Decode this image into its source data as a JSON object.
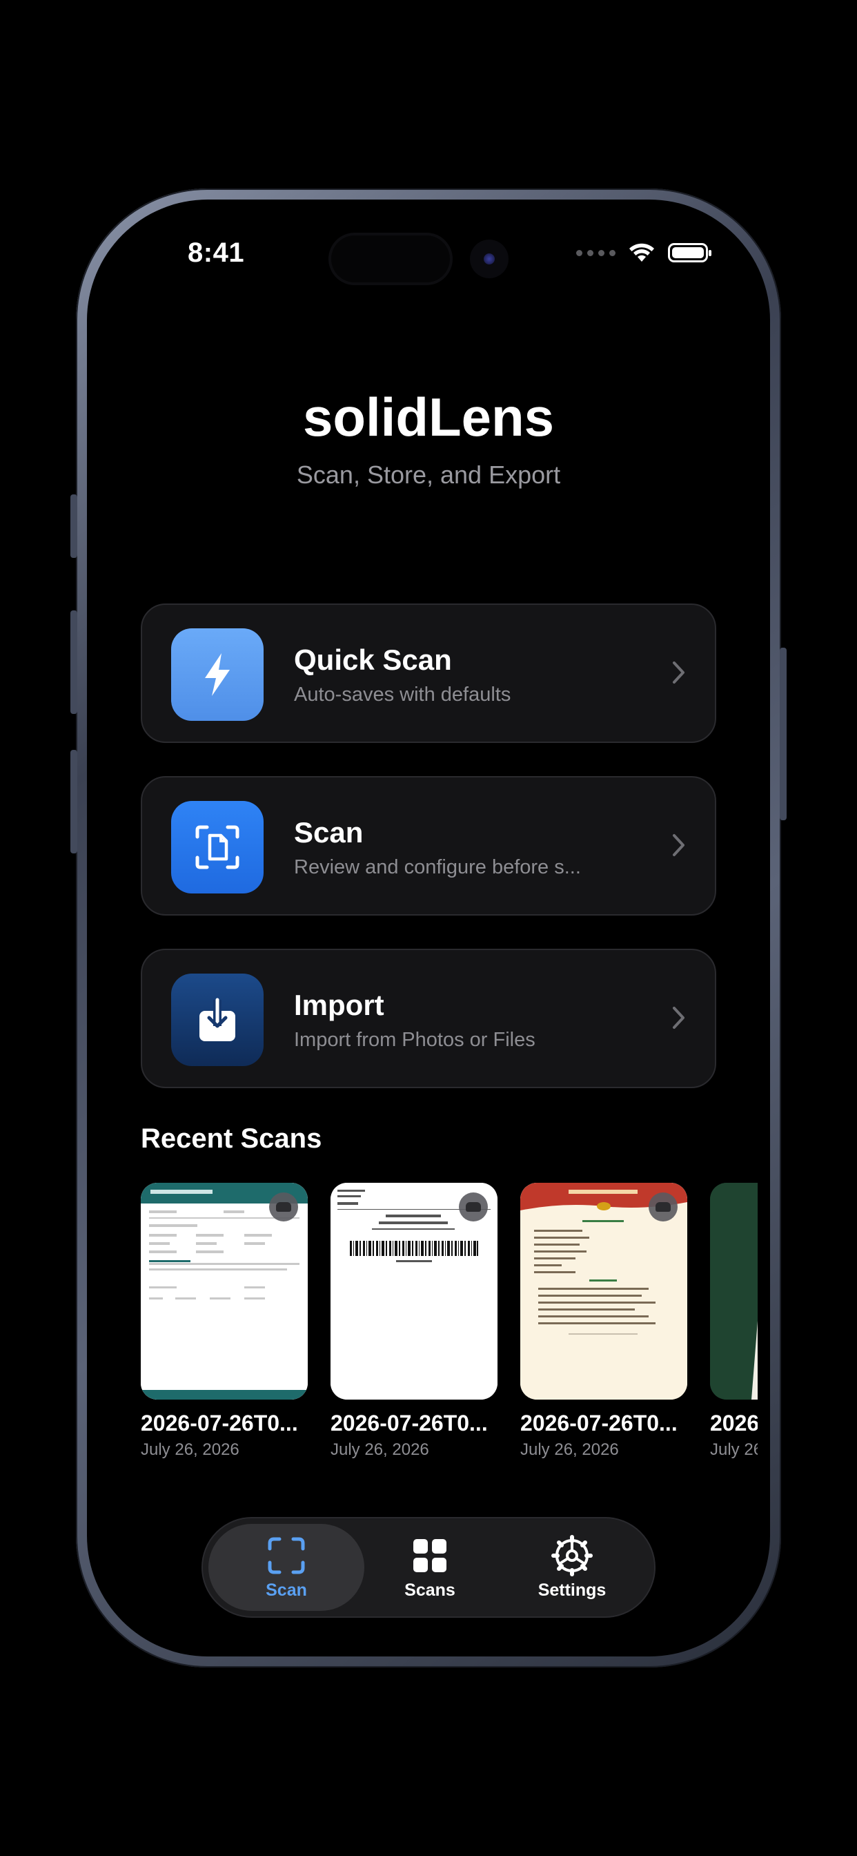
{
  "status_bar": {
    "time": "8:41"
  },
  "header": {
    "title": "solidLens",
    "subtitle": "Scan, Store, and Export"
  },
  "actions": [
    {
      "title": "Quick Scan",
      "subtitle": "Auto-saves with defaults",
      "icon": "bolt-icon",
      "color": "#5b9cf0"
    },
    {
      "title": "Scan",
      "subtitle": "Review and configure before s...",
      "icon": "document-scan-icon",
      "color": "#2a7af0"
    },
    {
      "title": "Import",
      "subtitle": "Import from Photos or Files",
      "icon": "download-icon",
      "color": "#16386e"
    }
  ],
  "recent": {
    "title": "Recent Scans",
    "items": [
      {
        "name": "2026-07-26T0...",
        "date": "July 26, 2026"
      },
      {
        "name": "2026-07-26T0...",
        "date": "July 26, 2026"
      },
      {
        "name": "2026-07-26T0...",
        "date": "July 26, 2026"
      },
      {
        "name": "2026",
        "date": "July 26"
      }
    ]
  },
  "tabbar": {
    "tabs": [
      {
        "label": "Scan",
        "icon": "scan-frame-icon",
        "active": true
      },
      {
        "label": "Scans",
        "icon": "grid-icon",
        "active": false
      },
      {
        "label": "Settings",
        "icon": "gear-icon",
        "active": false
      }
    ]
  },
  "colors": {
    "accent": "#5aa0f2",
    "background": "#000000",
    "card": "#141416"
  }
}
